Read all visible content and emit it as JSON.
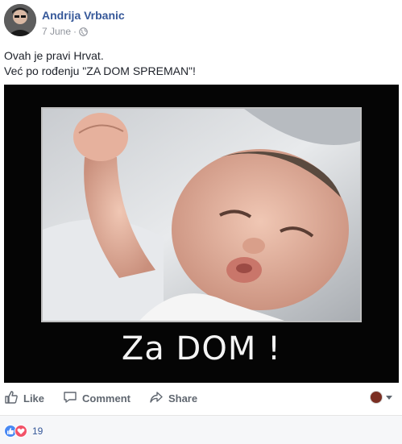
{
  "post": {
    "author_name": "Andrija Vrbanic",
    "date": "7 June",
    "separator": "·",
    "privacy_icon": "globe-icon",
    "text_line_1": "Ovah je pravi Hrvat.",
    "text_line_2": "Već po rođenju \"ZA DOM SPREMAN\"!",
    "image_caption": "Za DOM !"
  },
  "actions": {
    "like_label": "Like",
    "comment_label": "Comment",
    "share_label": "Share",
    "link_color": "#365899",
    "action_color": "#606770"
  },
  "reactions": {
    "types": [
      "like-icon",
      "love-icon"
    ],
    "count": "19",
    "like_color": "#4a89f3",
    "love_color": "#f25268"
  }
}
